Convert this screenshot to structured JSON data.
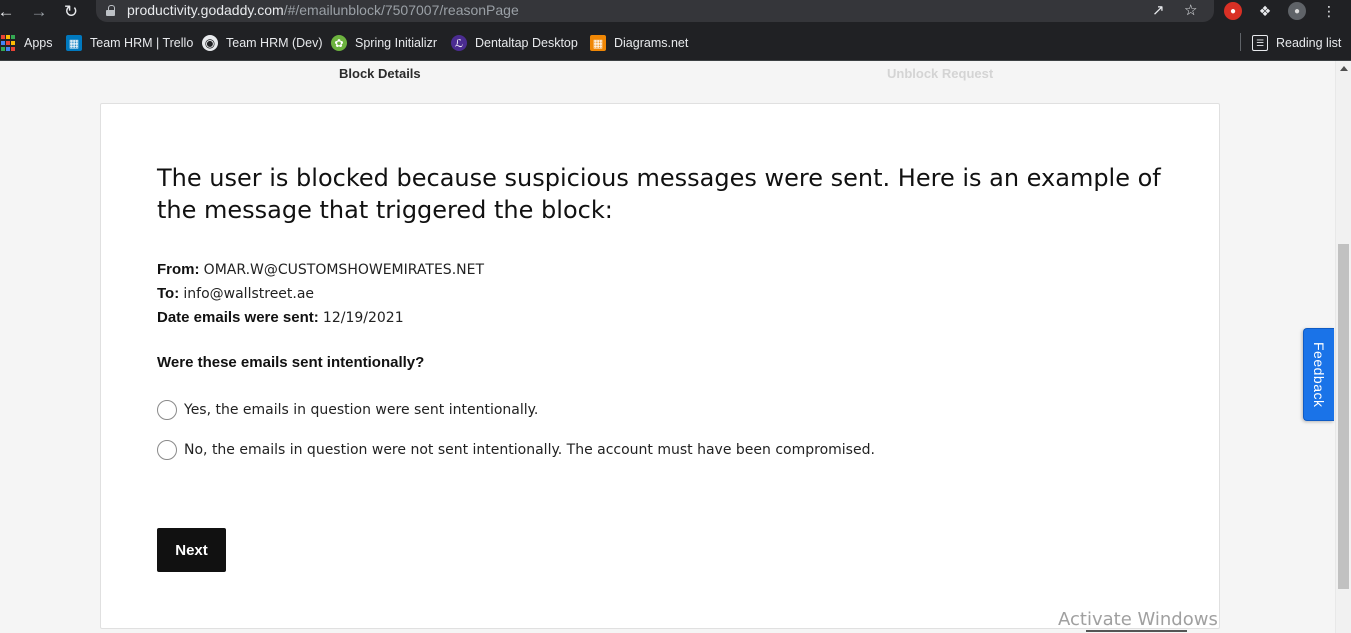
{
  "browser": {
    "url_host": "productivity.godaddy.com",
    "url_path": "/#/emailunblock/7507007/reasonPage",
    "reading_list_label": "Reading list",
    "bookmarks": [
      {
        "label": "Apps",
        "icon": "apps-grid-icon"
      },
      {
        "label": "Team HRM | Trello",
        "icon": "trello-icon"
      },
      {
        "label": "Team HRM (Dev)",
        "icon": "globe-icon"
      },
      {
        "label": "Spring Initializr",
        "icon": "spring-leaf-icon"
      },
      {
        "label": "Dentaltap Desktop",
        "icon": "dentaltap-icon"
      },
      {
        "label": "Diagrams.net",
        "icon": "diagrams-icon"
      }
    ]
  },
  "steps": {
    "active": "Block Details",
    "inactive": "Unblock Request"
  },
  "content": {
    "headline": "The user is blocked because suspicious messages were sent. Here is an example of the message that triggered the block:",
    "from_label": "From:",
    "from_value": "OMAR.W@CUSTOMSHOWEMIRATES.NET",
    "to_label": "To:",
    "to_value": "info@wallstreet.ae",
    "date_label": "Date emails were sent:",
    "date_value": "12/19/2021",
    "question": "Were these emails sent intentionally?",
    "options": [
      {
        "label": "Yes, the emails in question were sent intentionally."
      },
      {
        "label": "No, the emails in question were not sent intentionally. The account must have been compromised."
      }
    ],
    "next_label": "Next"
  },
  "feedback_label": "Feedback",
  "watermark": "Activate Windows",
  "colors": {
    "accent": "#1a73e8",
    "button_bg": "#111111",
    "chrome_bg": "#202124"
  }
}
